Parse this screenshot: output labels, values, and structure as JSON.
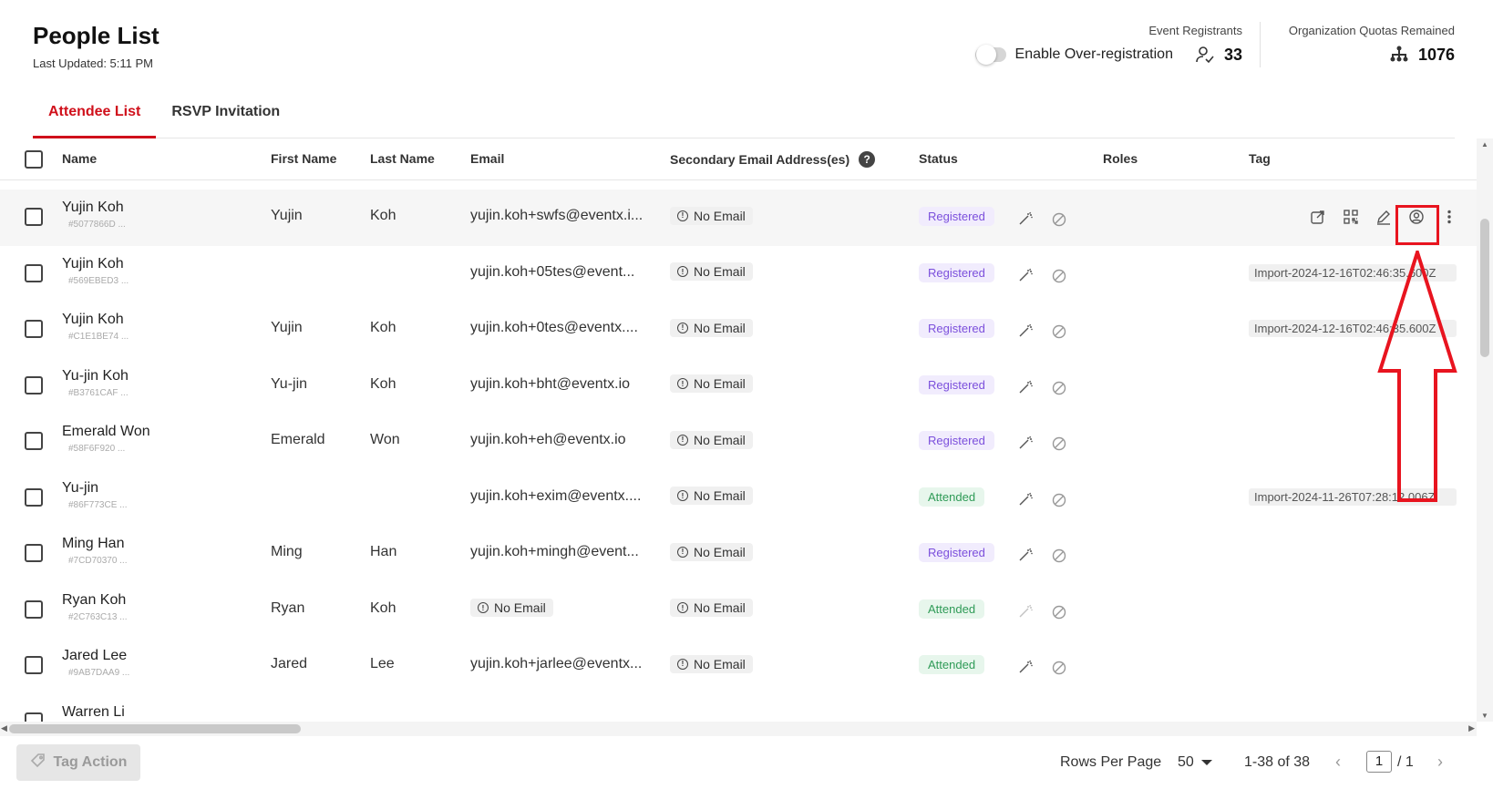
{
  "header": {
    "title": "People List",
    "last_updated": "Last Updated: 5:11 PM",
    "event_registrants_label": "Event Registrants",
    "over_registration_label": "Enable Over-registration",
    "over_registration_enabled": false,
    "event_registrants_count": "33",
    "org_quota_label": "Organization Quotas Remained",
    "org_quota_count": "1076"
  },
  "tabs": [
    {
      "label": "Attendee List",
      "active": true
    },
    {
      "label": "RSVP Invitation",
      "active": false
    }
  ],
  "columns": {
    "name": "Name",
    "first_name": "First Name",
    "last_name": "Last Name",
    "email": "Email",
    "secondary_email": "Secondary Email Address(es)",
    "status": "Status",
    "roles": "Roles",
    "tag": "Tag"
  },
  "no_email_label": "No Email",
  "rows": [
    {
      "name": "Yujin Koh",
      "id": "#5077866D ...",
      "first": "Yujin",
      "last": "Koh",
      "email": "yujin.koh+swfs@eventx.i...",
      "email_none": false,
      "status": "Registered",
      "status_type": "reg",
      "tag": "",
      "highlight": true
    },
    {
      "name": "Yujin Koh",
      "id": "#569EBED3 ...",
      "first": "",
      "last": "",
      "email": "yujin.koh+05tes@event...",
      "email_none": false,
      "status": "Registered",
      "status_type": "reg",
      "tag": "Import-2024-12-16T02:46:35.600Z",
      "highlight": false
    },
    {
      "name": "Yujin Koh",
      "id": "#C1E1BE74 ...",
      "first": "Yujin",
      "last": "Koh",
      "email": "yujin.koh+0tes@eventx....",
      "email_none": false,
      "status": "Registered",
      "status_type": "reg",
      "tag": "Import-2024-12-16T02:46:35.600Z",
      "highlight": false
    },
    {
      "name": "Yu-jin Koh",
      "id": "#B3761CAF ...",
      "first": "Yu-jin",
      "last": "Koh",
      "email": "yujin.koh+bht@eventx.io",
      "email_none": false,
      "status": "Registered",
      "status_type": "reg",
      "tag": "",
      "highlight": false
    },
    {
      "name": "Emerald Won",
      "id": "#58F6F920 ...",
      "first": "Emerald",
      "last": "Won",
      "email": "yujin.koh+eh@eventx.io",
      "email_none": false,
      "status": "Registered",
      "status_type": "reg",
      "tag": "",
      "highlight": false
    },
    {
      "name": "Yu-jin",
      "id": "#86F773CE ...",
      "first": "",
      "last": "",
      "email": "yujin.koh+exim@eventx....",
      "email_none": false,
      "status": "Attended",
      "status_type": "att",
      "tag": "Import-2024-11-26T07:28:12.006Z",
      "highlight": false
    },
    {
      "name": "Ming Han",
      "id": "#7CD70370 ...",
      "first": "Ming",
      "last": "Han",
      "email": "yujin.koh+mingh@event...",
      "email_none": false,
      "status": "Registered",
      "status_type": "reg",
      "tag": "",
      "highlight": false
    },
    {
      "name": "Ryan Koh",
      "id": "#2C763C13 ...",
      "first": "Ryan",
      "last": "Koh",
      "email": "No Email",
      "email_none": true,
      "status": "Attended",
      "status_type": "att",
      "tag": "",
      "highlight": false
    },
    {
      "name": "Jared Lee",
      "id": "#9AB7DAA9 ...",
      "first": "Jared",
      "last": "Lee",
      "email": "yujin.koh+jarlee@eventx...",
      "email_none": false,
      "status": "Attended",
      "status_type": "att",
      "tag": "",
      "highlight": false
    },
    {
      "name": "Warren Li",
      "id": "",
      "first": "",
      "last": "",
      "email": "",
      "email_none": false,
      "status": "",
      "status_type": "",
      "tag": "",
      "highlight": false
    }
  ],
  "footer": {
    "tag_action_label": "Tag Action",
    "rows_per_page_label": "Rows Per Page",
    "rows_per_page_value": "50",
    "range_label": "1-38 of 38",
    "current_page": "1",
    "total_pages": "/ 1"
  },
  "colors": {
    "accent": "#d0101b",
    "registered": "#7b4fdc",
    "attended": "#2f9b57",
    "annotation": "#e8141f"
  }
}
